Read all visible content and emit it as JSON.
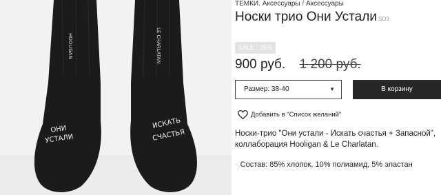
{
  "photo": {
    "alt": "socks-photo",
    "left_sock_text": [
      "ОНИ",
      "УСТАЛИ"
    ],
    "right_sock_text": [
      "ИСКАТЬ",
      "СЧАСТЬЯ"
    ],
    "cuff_text_left": "HOOLIGAN",
    "cuff_text_right": "LE CHARLATAN"
  },
  "breadcrumb": {
    "store": "ТЕМКИ.",
    "category": "Аксессуары",
    "separator": "/",
    "current": "Аксессуары"
  },
  "product": {
    "title": "Носки трио Они Устали",
    "sku": "SO3",
    "sale_badge": "SALE - 25%",
    "price": "900 руб.",
    "old_price": "1 200 руб.",
    "description": "Носки-трио \"Они устали - Искать счастья + Запасной\", коллаборация Hooligan & Le Charlatan.",
    "composition": "Состав: 85% хлопок, 10% полиамид, 5% эластан"
  },
  "controls": {
    "size_select": "Размер: 38-40",
    "cart_button": "В корзину",
    "wishlist_label": "Добавить в \"Список желаний\""
  },
  "colors": {
    "accent": "#272727",
    "badge": "#e3e3e3",
    "sock": "#1b1b1b"
  }
}
